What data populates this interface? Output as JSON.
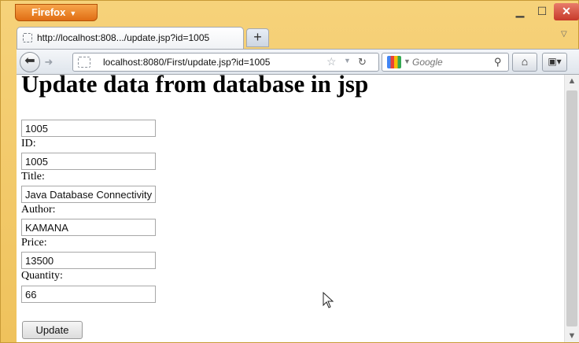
{
  "browser": {
    "app_button": "Firefox",
    "tab_title": "http://localhost:808.../update.jsp?id=1005",
    "url": "localhost:8080/First/update.jsp?id=1005",
    "search_placeholder": "Google"
  },
  "page": {
    "heading": "Update data from database in jsp",
    "hidden_id_value": "1005",
    "fields": [
      {
        "label": "ID:",
        "value": "1005"
      },
      {
        "label": "Title:",
        "value": "Java Database Connectivity"
      },
      {
        "label": "Author:",
        "value": "KAMANA"
      },
      {
        "label": "Price:",
        "value": "13500"
      },
      {
        "label": "Quantity:",
        "value": "66"
      }
    ],
    "submit_label": "Update"
  },
  "colors": {
    "window_frame": "#f2ca6a",
    "firefox_button": "#e06d14",
    "close_button": "#c7392a"
  }
}
